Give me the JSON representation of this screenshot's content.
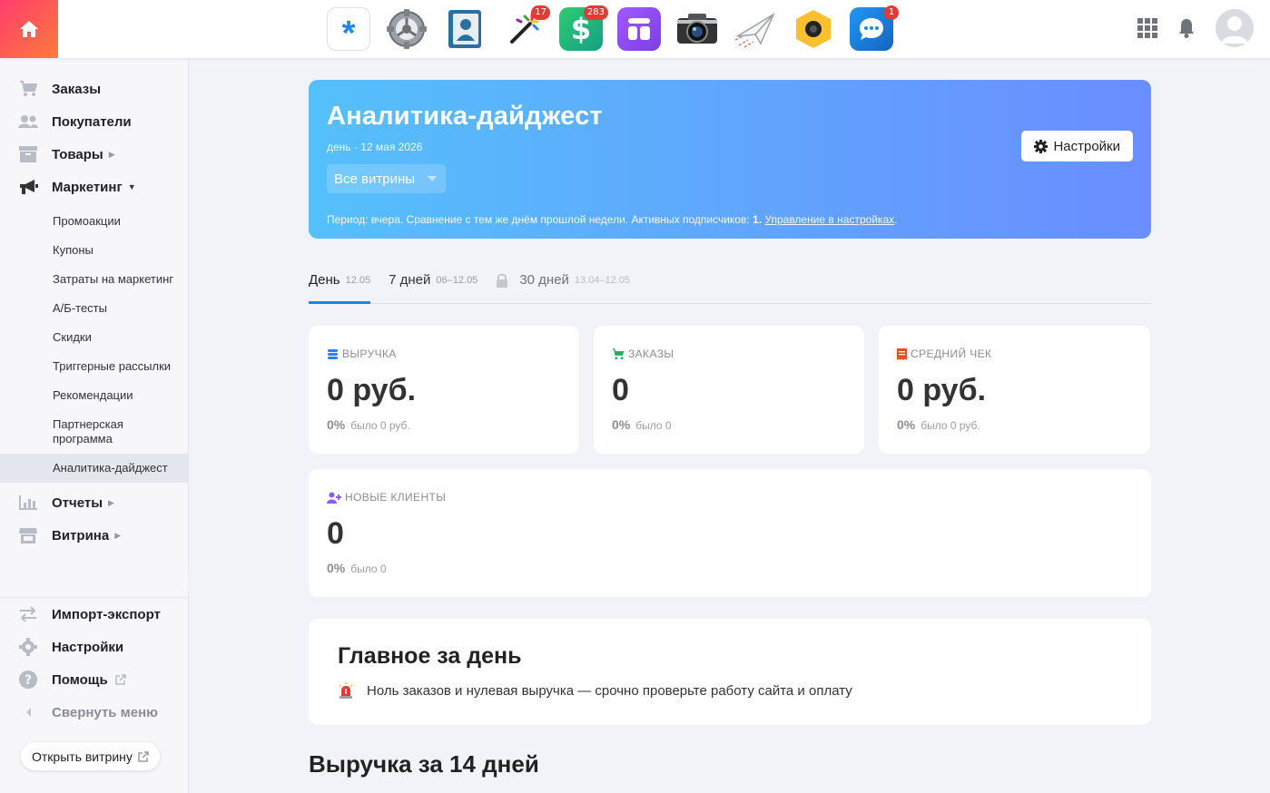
{
  "topbar": {
    "apps": [
      {
        "icon": "asterisk-app-icon",
        "badge": ""
      },
      {
        "icon": "gear-app-icon",
        "badge": ""
      },
      {
        "icon": "contacts-app-icon",
        "badge": ""
      },
      {
        "icon": "magic-wand-app-icon",
        "badge": "17"
      },
      {
        "icon": "dollar-app-icon",
        "badge": "283"
      },
      {
        "icon": "shapes-app-icon",
        "badge": ""
      },
      {
        "icon": "camera-app-icon",
        "badge": ""
      },
      {
        "icon": "paper-plane-app-icon",
        "badge": ""
      },
      {
        "icon": "webcam-app-icon",
        "badge": ""
      },
      {
        "icon": "chat-app-icon",
        "badge": "1"
      }
    ]
  },
  "sidebar": {
    "items": {
      "orders": "Заказы",
      "customers": "Покупатели",
      "products": "Товары",
      "marketing": "Маркетинг",
      "reports": "Отчеты",
      "storefront": "Витрина",
      "import_export": "Импорт-экспорт",
      "settings": "Настройки",
      "help": "Помощь",
      "collapse": "Свернуть меню"
    },
    "marketing_sub": {
      "promos": "Промоакции",
      "coupons": "Купоны",
      "costs": "Затраты на маркетинг",
      "ab_tests": "А/Б-тесты",
      "discounts": "Скидки",
      "triggers": "Триггерные рассылки",
      "recommendations": "Рекомендации",
      "partner": "Партнерская программа",
      "digest": "Аналитика-дайджест"
    },
    "open_store": "Открыть витрину"
  },
  "hero": {
    "title": "Аналитика-дайджест",
    "subtitle": "день · 12 мая 2026",
    "store_select": "Все витрины",
    "period_text": "Период: вчера. Сравнение с тем же днём прошлой недели. Активных подписчиков: ",
    "subscribers": "1.",
    "manage_link": "Управление в настройках",
    "period_end": ".",
    "settings_button": "Настройки"
  },
  "tabs": [
    {
      "label": "День",
      "range": "12.05"
    },
    {
      "label": "7 дней",
      "range": "06–12.05"
    },
    {
      "label": "30 дней",
      "range": "13.04–12.05"
    }
  ],
  "metrics": {
    "revenue": {
      "label": "ВЫРУЧКА",
      "value": "0 руб.",
      "pct": "0%",
      "was": "было 0 руб."
    },
    "orders": {
      "label": "ЗАКАЗЫ",
      "value": "0",
      "pct": "0%",
      "was": "было 0"
    },
    "avg_check": {
      "label": "СРЕДНИЙ ЧЕК",
      "value": "0 руб.",
      "pct": "0%",
      "was": "было 0 руб."
    },
    "new_clients": {
      "label": "НОВЫЕ КЛИЕНТЫ",
      "value": "0",
      "pct": "0%",
      "was": "было 0"
    }
  },
  "summary": {
    "title": "Главное за день",
    "alert": "Ноль заказов и нулевая выручка — срочно проверьте работу сайта и оплату"
  },
  "revenue_section_title": "Выручка за 14 дней",
  "colors": {
    "accent": "#1a86e8",
    "hero_start": "#55c0fb",
    "hero_end": "#6a8dff",
    "home_start": "#ff3d6e",
    "home_end": "#ff7a3a"
  }
}
